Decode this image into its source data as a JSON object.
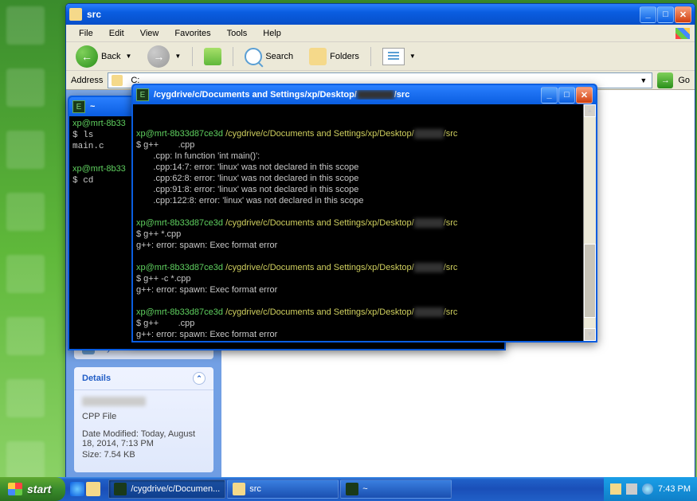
{
  "explorer": {
    "title": "src",
    "menubar": {
      "file": "File",
      "edit": "Edit",
      "view": "View",
      "favorites": "Favorites",
      "tools": "Tools",
      "help": "Help"
    },
    "toolbar": {
      "back": "Back",
      "search": "Search",
      "folders": "Folders"
    },
    "addressbar": {
      "label": "Address",
      "value": "C:",
      "go": "Go"
    },
    "details_panel": {
      "title": "Details",
      "filetype": "CPP File",
      "modified": "Date Modified: Today, August 18, 2014, 7:13 PM",
      "size": "Size: 7.54 KB"
    },
    "other_places_item": "My Network Places"
  },
  "term_back": {
    "title": "~",
    "lines": [
      {
        "prompt": "xp@mrt-8b33",
        "rest": ""
      },
      {
        "cmd": "$ ls"
      },
      {
        "out": "main.c"
      },
      {
        "blank": true
      },
      {
        "prompt": "xp@mrt-8b33",
        "rest": ""
      },
      {
        "cmd": "$ cd "
      }
    ]
  },
  "term_front": {
    "title": "/cygdrive/c/Documents and Settings/xp/Desktop/",
    "title_suffix": "/src",
    "path_prefix": "/cygdrive/c/Documents and Settings/xp/Desktop/",
    "path_suffix": "/src",
    "prompt_user": "xp@mrt-8b33d87ce3d",
    "blocks": [
      {
        "cmd": "$ g++        .cpp",
        "out": [
          "       .cpp: In function 'int main()':",
          "       .cpp:14:7: error: 'linux' was not declared in this scope",
          "       .cpp:62:8: error: 'linux' was not declared in this scope",
          "       .cpp:91:8: error: 'linux' was not declared in this scope",
          "       .cpp:122:8: error: 'linux' was not declared in this scope"
        ]
      },
      {
        "cmd": "$ g++ *.cpp",
        "out": [
          "g++: error: spawn: Exec format error"
        ]
      },
      {
        "cmd": "$ g++ -c *.cpp",
        "out": [
          "g++: error: spawn: Exec format error"
        ]
      },
      {
        "cmd": "$ g++        .cpp",
        "out": [
          "g++: error: spawn: Exec format error"
        ]
      },
      {
        "cmd": "$",
        "out": []
      }
    ]
  },
  "taskbar": {
    "start": "start",
    "tasks": [
      {
        "label": "/cygdrive/c/Documen...",
        "icon_bg": "#1a3a1a",
        "active": true
      },
      {
        "label": "src",
        "icon_bg": "#f5d98a",
        "active": false
      },
      {
        "label": "~",
        "icon_bg": "#1a3a1a",
        "active": false
      }
    ],
    "clock": "7:43 PM"
  }
}
